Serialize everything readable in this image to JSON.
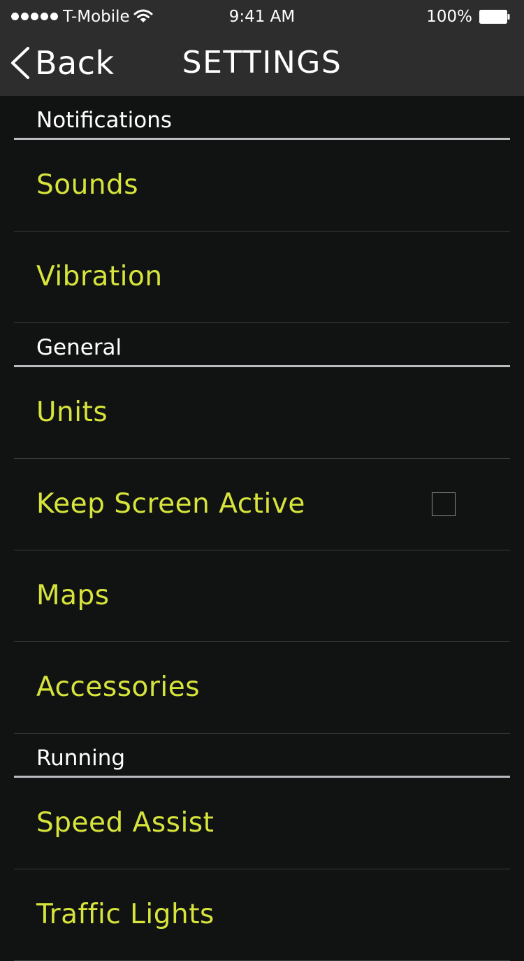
{
  "status_bar": {
    "carrier": "T-Mobile",
    "time": "9:41 AM",
    "battery_percent": "100%",
    "signal_bars": 5,
    "icons": [
      "signal-dots-icon",
      "wifi-icon",
      "battery-icon"
    ]
  },
  "nav": {
    "back_label": "Back",
    "title": "SETTINGS",
    "back_icon": "chevron-left-icon"
  },
  "sections": {
    "notifications": {
      "title": "Notifications",
      "items": [
        "Sounds",
        "Vibration"
      ]
    },
    "general": {
      "title": "General",
      "items": [
        "Units",
        "Keep Screen Active",
        "Maps",
        "Accessories"
      ],
      "keep_screen_active_checked": false
    },
    "running": {
      "title": "Running",
      "items": [
        "Speed Assist",
        "Traffic Lights"
      ]
    }
  },
  "colors": {
    "background": "#111212",
    "bar_background": "#2d2d2d",
    "accent": "#d6e43b",
    "section_rule": "#b9bcbf",
    "row_divider": "#3a3c3e"
  }
}
